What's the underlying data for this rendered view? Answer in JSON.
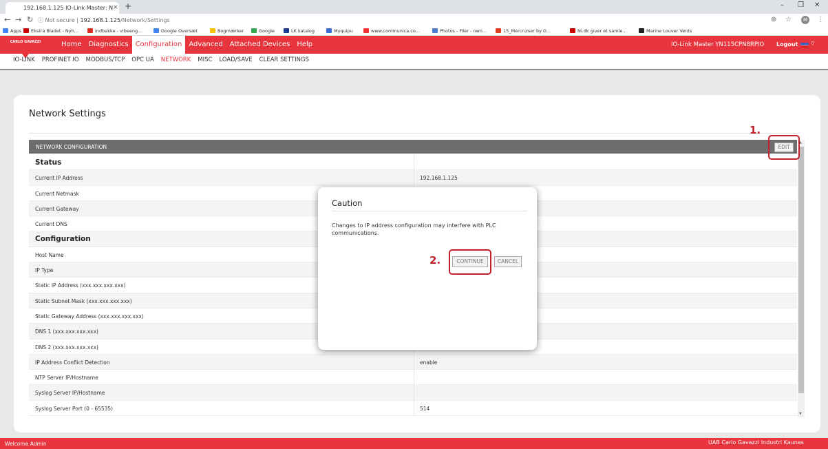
{
  "browser": {
    "tab_title": "192.168.1.125 IO-Link Master: N",
    "tab_close": "×",
    "new_tab": "+",
    "url_security": "ⓘ Not secure",
    "url_host": "192.168.1.125",
    "url_path": "/Network/Settings",
    "profile_initial": "M",
    "bookmarks": [
      "Apps",
      "Ekstra Bladet - Nyh...",
      "Indbakke - vibeeng...",
      "Google Oversæt",
      "Bogmærker",
      "Google",
      "LK katalog",
      "Myquipu",
      "www.communica.co...",
      "Photos - Filer - own...",
      "15_Mercruiser by G...",
      "Ni.dk giver et samle...",
      "Marine Louver Vents"
    ]
  },
  "header": {
    "logo_text": "CARLO GAVAZZI",
    "nav": [
      "Home",
      "Diagnostics",
      "Configuration",
      "Advanced",
      "Attached Devices",
      "Help"
    ],
    "device_name": "IO-Link Master YN115CPN8RPIO",
    "logout": "Logout",
    "subnav": [
      "IO-LINK",
      "PROFINET IO",
      "MODBUS/TCP",
      "OPC UA",
      "NETWORK",
      "MISC",
      "LOAD/SAVE",
      "CLEAR SETTINGS"
    ]
  },
  "page": {
    "title": "Network Settings",
    "section_header": "NETWORK CONFIGURATION",
    "edit_label": "EDIT",
    "rows": [
      {
        "label": "Status",
        "value": "",
        "group": true
      },
      {
        "label": "Current IP Address",
        "value": "192.168.1.125"
      },
      {
        "label": "Current Netmask",
        "value": ""
      },
      {
        "label": "Current Gateway",
        "value": ""
      },
      {
        "label": "Current DNS",
        "value": ""
      },
      {
        "label": "Configuration",
        "value": "",
        "group": true
      },
      {
        "label": "Host Name",
        "value": ""
      },
      {
        "label": "IP Type",
        "value": ""
      },
      {
        "label": "Static IP Address (xxx.xxx.xxx.xxx)",
        "value": ""
      },
      {
        "label": "Static Subnet Mask (xxx.xxx.xxx.xxx)",
        "value": ""
      },
      {
        "label": "Static Gateway Address (xxx.xxx.xxx.xxx)",
        "value": ""
      },
      {
        "label": "DNS 1 (xxx.xxx.xxx.xxx)",
        "value": ""
      },
      {
        "label": "DNS 2 (xxx.xxx.xxx.xxx)",
        "value": ""
      },
      {
        "label": "IP Address Conflict Detection",
        "value": "enable"
      },
      {
        "label": "NTP Server IP/Hostname",
        "value": ""
      },
      {
        "label": "Syslog Server IP/Hostname",
        "value": ""
      },
      {
        "label": "Syslog Server Port (0 - 65535)",
        "value": "514"
      }
    ]
  },
  "dialog": {
    "title": "Caution",
    "message": "Changes to IP address configuration may interfere with PLC communications.",
    "continue_label": "CONTINUE",
    "cancel_label": "CANCEL"
  },
  "annotations": {
    "step1": "1.",
    "step2": "2."
  },
  "footer": {
    "left": "Welcome Admin",
    "right": "UAB Carlo Gavazzi Industri Kaunas"
  },
  "colors": {
    "brand_red": "#e8343d",
    "annotation_red": "#c2212b",
    "section_gray": "#6d6d6d"
  }
}
